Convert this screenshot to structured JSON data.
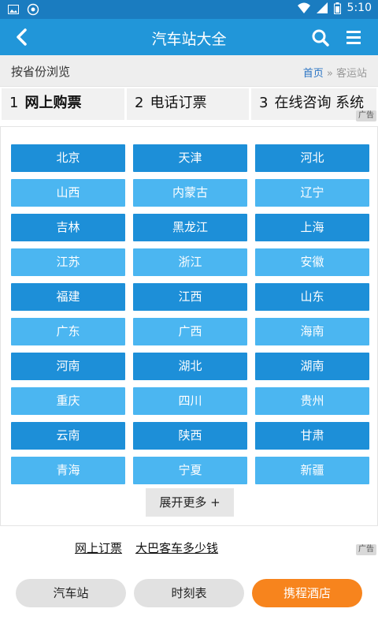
{
  "status_bar": {
    "time": "5:10"
  },
  "header": {
    "title": "汽车站大全",
    "back_icon": "back-arrow-icon",
    "search_icon": "search-icon",
    "menu_icon": "menu-icon"
  },
  "browse": {
    "label": "按省份浏览",
    "breadcrumb_home": "首页",
    "breadcrumb_sep": " » ",
    "breadcrumb_current": "客运站"
  },
  "ad_tabs": {
    "items": [
      {
        "num": "1",
        "label": "网上购票"
      },
      {
        "num": "2",
        "label": "电话订票"
      },
      {
        "num": "3",
        "label": "在线咨询 系统"
      }
    ],
    "ad_badge": "广告"
  },
  "provinces": [
    "北京",
    "天津",
    "河北",
    "山西",
    "内蒙古",
    "辽宁",
    "吉林",
    "黑龙江",
    "上海",
    "江苏",
    "浙江",
    "安徽",
    "福建",
    "江西",
    "山东",
    "广东",
    "广西",
    "海南",
    "河南",
    "湖北",
    "湖南",
    "重庆",
    "四川",
    "贵州",
    "云南",
    "陕西",
    "甘肃",
    "青海",
    "宁夏",
    "新疆"
  ],
  "expand_more": "展开更多 +",
  "links": {
    "link1": "网上订票",
    "link2": "大巴客车多少钱",
    "ad_badge": "广告"
  },
  "bottom_nav": {
    "station": "汽车站",
    "timetable": "时刻表",
    "hotel": "携程酒店"
  },
  "colors": {
    "header": "#2196d9",
    "status_bar": "#1a7cc0",
    "province_dark": "#1d8fd8",
    "province_light": "#4bb6f1",
    "accent_orange": "#f7841d",
    "link_blue": "#2a74c4"
  }
}
